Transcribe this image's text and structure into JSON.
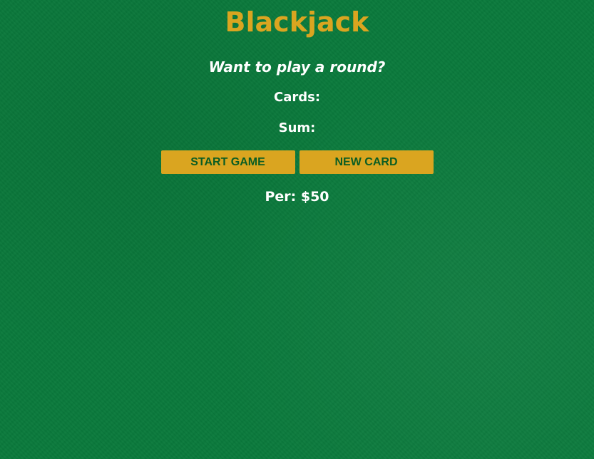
{
  "title": "Blackjack",
  "message": "Want to play a round?",
  "cards_label": "Cards:",
  "sum_label": "Sum:",
  "buttons": {
    "start": "START GAME",
    "new_card": "NEW CARD"
  },
  "player": "Per: $50",
  "colors": {
    "felt": "#0a7a3c",
    "gold": "#daa520",
    "button_text": "#0b5d23"
  }
}
